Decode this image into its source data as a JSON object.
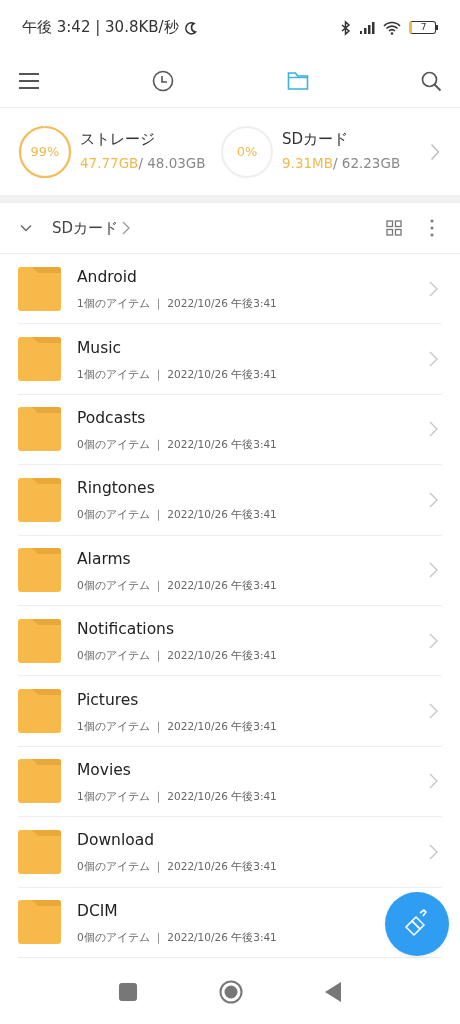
{
  "status_bar": {
    "time": "午後 3:42 | 30.8KB/秒",
    "battery": "7"
  },
  "tabs": [
    {
      "kind": "recent",
      "selected": false
    },
    {
      "kind": "files",
      "selected": true
    }
  ],
  "storage": [
    {
      "percent": "99%",
      "label": "ストレージ",
      "used": "47.77GB",
      "total": "/ 48.03GB"
    },
    {
      "percent": "0%",
      "label": "SDカード",
      "used": "9.31MB",
      "total": "/ 62.23GB"
    }
  ],
  "breadcrumb": {
    "label": "SDカード",
    "expanded": true
  },
  "folders": [
    {
      "name": "Android",
      "meta": "1個のアイテム ｜ 2022/10/26 午後3:41"
    },
    {
      "name": "Music",
      "meta": "1個のアイテム ｜ 2022/10/26 午後3:41"
    },
    {
      "name": "Podcasts",
      "meta": "0個のアイテム ｜ 2022/10/26 午後3:41"
    },
    {
      "name": "Ringtones",
      "meta": "0個のアイテム ｜ 2022/10/26 午後3:41"
    },
    {
      "name": "Alarms",
      "meta": "0個のアイテム ｜ 2022/10/26 午後3:41"
    },
    {
      "name": "Notifications",
      "meta": "0個のアイテム ｜ 2022/10/26 午後3:41"
    },
    {
      "name": "Pictures",
      "meta": "1個のアイテム ｜ 2022/10/26 午後3:41"
    },
    {
      "name": "Movies",
      "meta": "1個のアイテム ｜ 2022/10/26 午後3:41"
    },
    {
      "name": "Download",
      "meta": "0個のアイテム ｜ 2022/10/26 午後3:41"
    },
    {
      "name": "DCIM",
      "meta": "0個のアイテム ｜ 2022/10/26 午後3:41"
    }
  ]
}
